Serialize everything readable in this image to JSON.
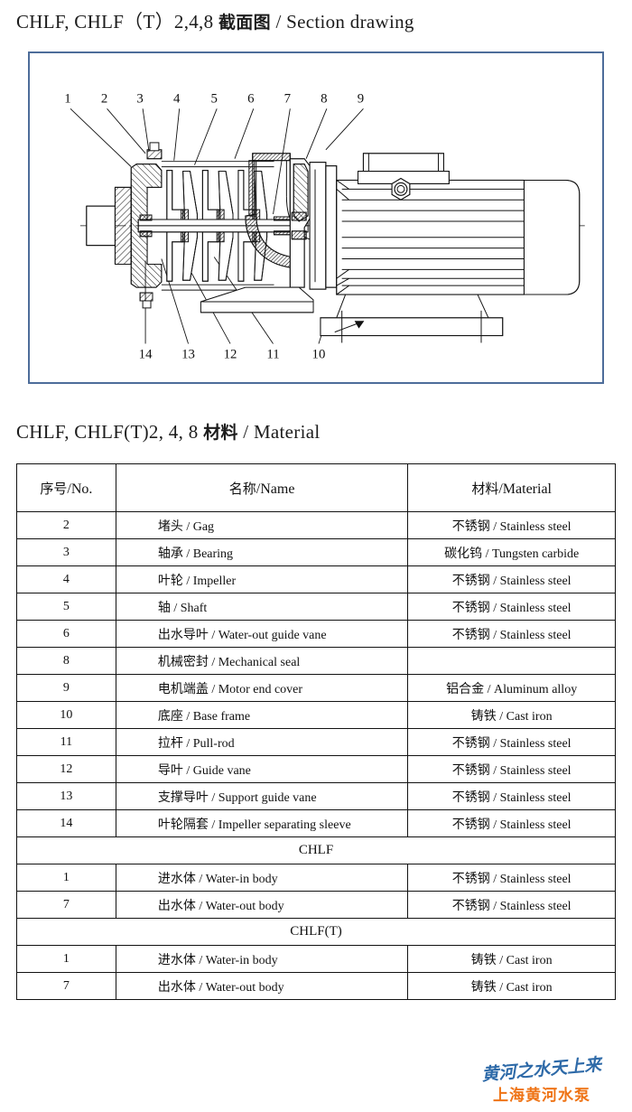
{
  "headings": {
    "section_drawing": {
      "model": "CHLF, CHLF（T）2,4,8",
      "cjk": "截面图",
      "separator": "/",
      "latin": "Section drawing"
    },
    "material": {
      "model": "CHLF, CHLF(T)2, 4, 8",
      "cjk": "材料",
      "separator": "/",
      "latin": "Material"
    }
  },
  "drawing": {
    "panel_border_color": "#4d6d9a",
    "callouts_top": [
      "1",
      "2",
      "3",
      "4",
      "5",
      "6",
      "7",
      "8",
      "9"
    ],
    "callouts_bottom": [
      "14",
      "13",
      "12",
      "11",
      "10"
    ]
  },
  "table": {
    "headers": [
      {
        "cjk": "序号",
        "sep": "/",
        "latin": "No."
      },
      {
        "cjk": "名称",
        "sep": "/",
        "latin": "Name"
      },
      {
        "cjk": "材料",
        "sep": "/",
        "latin": "Material"
      }
    ],
    "rows": [
      {
        "no": "2",
        "name_cjk": "堵头",
        "name_latin": "Gag",
        "mat_cjk": "不锈钢",
        "mat_latin": "Stainless steel"
      },
      {
        "no": "3",
        "name_cjk": "轴承",
        "name_latin": "Bearing",
        "mat_cjk": "碳化钨",
        "mat_latin": "Tungsten carbide"
      },
      {
        "no": "4",
        "name_cjk": "叶轮",
        "name_latin": "Impeller",
        "mat_cjk": "不锈钢",
        "mat_latin": "Stainless steel"
      },
      {
        "no": "5",
        "name_cjk": "轴",
        "name_latin": "Shaft",
        "mat_cjk": "不锈钢",
        "mat_latin": "Stainless steel"
      },
      {
        "no": "6",
        "name_cjk": "出水导叶",
        "name_latin": "Water-out guide vane",
        "mat_cjk": "不锈钢",
        "mat_latin": "Stainless steel"
      },
      {
        "no": "8",
        "name_cjk": "机械密封",
        "name_latin": "Mechanical seal",
        "mat_cjk": "",
        "mat_latin": ""
      },
      {
        "no": "9",
        "name_cjk": "电机端盖",
        "name_latin": "Motor end cover",
        "mat_cjk": "铝合金",
        "mat_latin": "Aluminum alloy"
      },
      {
        "no": "10",
        "name_cjk": "底座",
        "name_latin": "Base frame",
        "mat_cjk": "铸铁",
        "mat_latin": "Cast iron"
      },
      {
        "no": "11",
        "name_cjk": "拉杆",
        "name_latin": "Pull-rod",
        "mat_cjk": "不锈钢",
        "mat_latin": "Stainless steel"
      },
      {
        "no": "12",
        "name_cjk": "导叶",
        "name_latin": "Guide vane",
        "mat_cjk": "不锈钢",
        "mat_latin": "Stainless steel"
      },
      {
        "no": "13",
        "name_cjk": "支撑导叶",
        "name_latin": "Support guide vane",
        "mat_cjk": "不锈钢",
        "mat_latin": "Stainless steel"
      },
      {
        "no": "14",
        "name_cjk": "叶轮隔套",
        "name_latin": "Impeller separating sleeve",
        "mat_cjk": "不锈钢",
        "mat_latin": "Stainless steel"
      }
    ],
    "group_chlf": {
      "label": "CHLF",
      "rows": [
        {
          "no": "1",
          "name_cjk": "进水体",
          "name_latin": "Water-in body",
          "mat_cjk": "不锈钢",
          "mat_latin": "Stainless steel"
        },
        {
          "no": "7",
          "name_cjk": "出水体",
          "name_latin": "Water-out body",
          "mat_cjk": "不锈钢",
          "mat_latin": "Stainless steel"
        }
      ]
    },
    "group_chlft": {
      "label": "CHLF(T)",
      "rows": [
        {
          "no": "1",
          "name_cjk": "进水体",
          "name_latin": "Water-in body",
          "mat_cjk": "铸铁",
          "mat_latin": "Cast iron"
        },
        {
          "no": "7",
          "name_cjk": "出水体",
          "name_latin": "Water-out body",
          "mat_cjk": "铸铁",
          "mat_latin": "Cast iron"
        }
      ]
    }
  },
  "logo": {
    "script_text": "黄河之水天上来",
    "company_text": "上海黄河水泵",
    "script_color": "#2e6aa8",
    "company_color": "#ef7416"
  }
}
